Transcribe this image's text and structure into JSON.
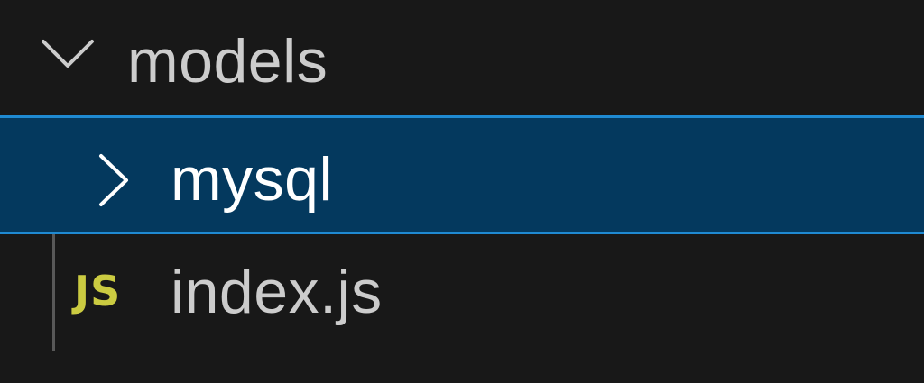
{
  "explorer": {
    "items": [
      {
        "label": "models",
        "kind": "folder",
        "expanded": true,
        "icon": "chevron-down-icon"
      },
      {
        "label": "mysql",
        "kind": "folder",
        "expanded": false,
        "selected": true,
        "icon": "chevron-right-icon"
      },
      {
        "label": "index.js",
        "kind": "file",
        "icon": "javascript-file-icon",
        "icon_text": "JS"
      }
    ]
  },
  "colors": {
    "background": "#181818",
    "selection_background": "#04395e",
    "selection_border": "#1f8ad2",
    "text": "#cccccc",
    "selected_text": "#ffffff",
    "js_icon": "#cbcb41",
    "indent_guide": "#585858"
  }
}
